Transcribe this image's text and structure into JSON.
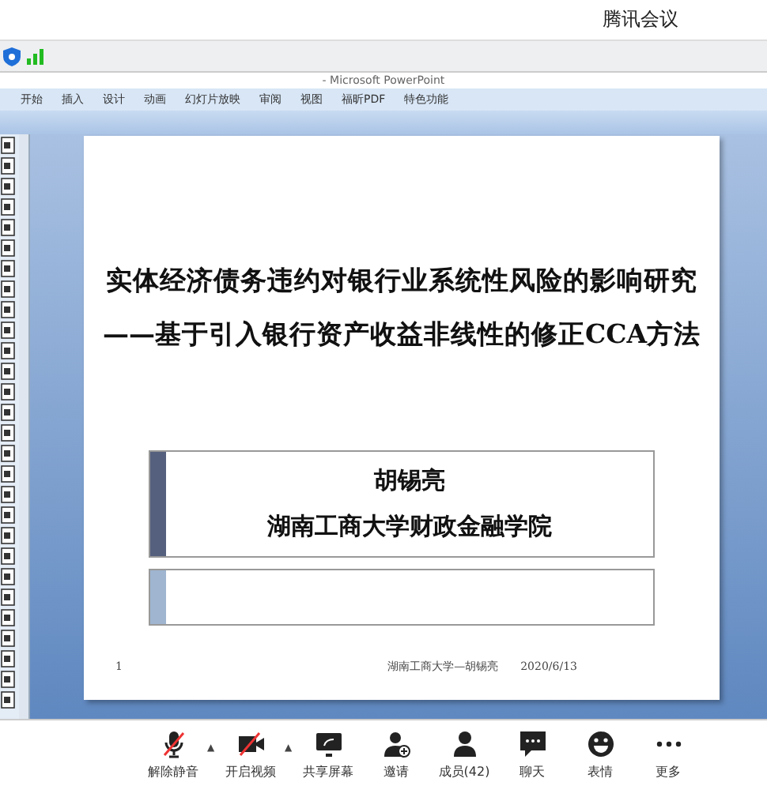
{
  "app": {
    "title": "腾讯会议"
  },
  "ppt": {
    "title": "- Microsoft PowerPoint",
    "ribbon_tabs": [
      {
        "label": "开始",
        "selected": false
      },
      {
        "label": "插入",
        "selected": false
      },
      {
        "label": "设计",
        "selected": false
      },
      {
        "label": "动画",
        "selected": false
      },
      {
        "label": "幻灯片放映",
        "selected": false
      },
      {
        "label": "审阅",
        "selected": false
      },
      {
        "label": "视图",
        "selected": false
      },
      {
        "label": "福昕PDF",
        "selected": false
      },
      {
        "label": "特色功能",
        "selected": false
      }
    ]
  },
  "slide": {
    "title_lines": [
      "实体经济债务违约对银行业系统性风险的影响研究",
      "——基于引入银行资产收益非线性的修正CCA方法"
    ],
    "author": "胡锡亮",
    "affiliation": "湖南工商大学财政金融学院",
    "page_number": "1",
    "footer": "湖南工商大学—胡锡亮",
    "date": "2020/6/13"
  },
  "toolbar": [
    {
      "kind": "mic",
      "label": "解除静音",
      "caret": true
    },
    {
      "kind": "video",
      "label": "开启视频",
      "caret": true
    },
    {
      "kind": "share",
      "label": "共享屏幕",
      "caret": false
    },
    {
      "kind": "invite",
      "label": "邀请",
      "caret": false
    },
    {
      "kind": "members",
      "label": "成员(42)",
      "caret": false
    },
    {
      "kind": "chat",
      "label": "聊天",
      "caret": false
    },
    {
      "kind": "emoji",
      "label": "表情",
      "caret": false
    },
    {
      "kind": "more",
      "label": "更多",
      "caret": false
    }
  ],
  "caret_glyph": "▲"
}
